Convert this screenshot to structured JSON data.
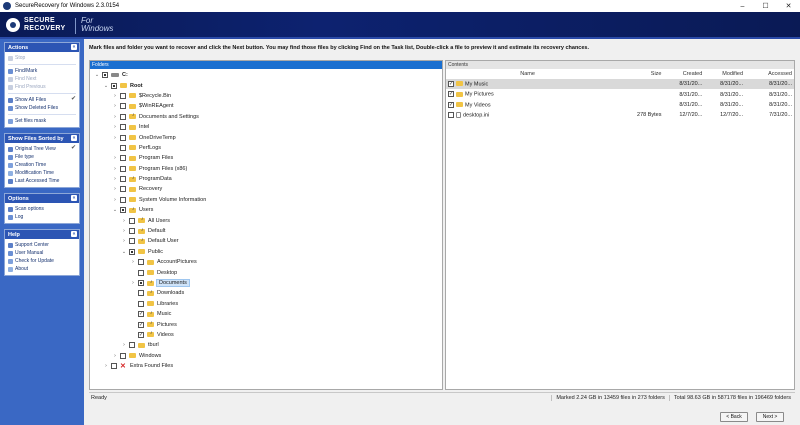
{
  "window": {
    "title": "SecureRecovery for Windows 2.3.0154",
    "minimize": "–",
    "maximize": "☐",
    "close": "✕"
  },
  "banner": {
    "logo_line1": "SECURE",
    "logo_line2": "RECOVERY",
    "logo_sub1": "For",
    "logo_sub2": "Windows"
  },
  "sidebar": {
    "actions": {
      "title": "Actions",
      "items": [
        {
          "label": "Stop",
          "disabled": true
        },
        {
          "label": "Find/Mark"
        },
        {
          "label": "Find Next",
          "disabled": true
        },
        {
          "label": "Find Previous",
          "disabled": true
        },
        {
          "label": "Show All Files",
          "checked": true
        },
        {
          "label": "Show Deleted Files"
        },
        {
          "label": "Set files mask"
        }
      ]
    },
    "sorted": {
      "title": "Show Files Sorted by",
      "items": [
        {
          "label": "Original Tree View",
          "checked": true
        },
        {
          "label": "File type"
        },
        {
          "label": "Creation Time"
        },
        {
          "label": "Modification Time"
        },
        {
          "label": "Last Accessed Time"
        }
      ]
    },
    "options": {
      "title": "Options",
      "items": [
        {
          "label": "Scan options"
        },
        {
          "label": "Log"
        }
      ]
    },
    "help": {
      "title": "Help",
      "items": [
        {
          "label": "Support Center"
        },
        {
          "label": "User Manual"
        },
        {
          "label": "Check for Update"
        },
        {
          "label": "About"
        }
      ]
    },
    "collapse_glyph": "«"
  },
  "main": {
    "instruction": "Mark files and folder you want to recover and click the Next button. You may find those files by clicking Find on the Task list, Double-click a file to preview it and estimate its recovery chances.",
    "folders_header": "Folders",
    "contents_header": "Contents",
    "tree": [
      {
        "label": "C:",
        "depth": 0,
        "exp": "⌄",
        "cb": "part",
        "icon": "drive",
        "bold": true
      },
      {
        "label": "Root",
        "depth": 1,
        "exp": "⌄",
        "cb": "part",
        "icon": "folder",
        "bold": true
      },
      {
        "label": "$Recycle.Bin",
        "depth": 2,
        "exp": "›",
        "cb": "",
        "icon": "folder"
      },
      {
        "label": "$WinREAgent",
        "depth": 2,
        "exp": "›",
        "cb": "",
        "icon": "folder"
      },
      {
        "label": "Documents and Settings",
        "depth": 2,
        "exp": "›",
        "cb": "",
        "icon": "music"
      },
      {
        "label": "Intel",
        "depth": 2,
        "exp": "›",
        "cb": "",
        "icon": "folder"
      },
      {
        "label": "OneDriveTemp",
        "depth": 2,
        "exp": "›",
        "cb": "",
        "icon": "folder"
      },
      {
        "label": "PerfLogs",
        "depth": 2,
        "exp": "",
        "cb": "",
        "icon": "folder"
      },
      {
        "label": "Program Files",
        "depth": 2,
        "exp": "›",
        "cb": "",
        "icon": "folder"
      },
      {
        "label": "Program Files (x86)",
        "depth": 2,
        "exp": "›",
        "cb": "",
        "icon": "folder"
      },
      {
        "label": "ProgramData",
        "depth": 2,
        "exp": "›",
        "cb": "",
        "icon": "music"
      },
      {
        "label": "Recovery",
        "depth": 2,
        "exp": "›",
        "cb": "",
        "icon": "folder"
      },
      {
        "label": "System Volume Information",
        "depth": 2,
        "exp": "›",
        "cb": "",
        "icon": "folder"
      },
      {
        "label": "Users",
        "depth": 2,
        "exp": "⌄",
        "cb": "part",
        "icon": "music"
      },
      {
        "label": "All Users",
        "depth": 3,
        "exp": "›",
        "cb": "",
        "icon": "music"
      },
      {
        "label": "Default",
        "depth": 3,
        "exp": "›",
        "cb": "",
        "icon": "music"
      },
      {
        "label": "Default User",
        "depth": 3,
        "exp": "›",
        "cb": "",
        "icon": "music"
      },
      {
        "label": "Public",
        "depth": 3,
        "exp": "⌄",
        "cb": "part",
        "icon": "folder"
      },
      {
        "label": "AccountPictures",
        "depth": 4,
        "exp": "›",
        "cb": "",
        "icon": "folder"
      },
      {
        "label": "Desktop",
        "depth": 4,
        "exp": "",
        "cb": "",
        "icon": "folder"
      },
      {
        "label": "Documents",
        "depth": 4,
        "exp": "›",
        "cb": "part",
        "icon": "music",
        "selected": true
      },
      {
        "label": "Downloads",
        "depth": 4,
        "exp": "",
        "cb": "",
        "icon": "music"
      },
      {
        "label": "Libraries",
        "depth": 4,
        "exp": "",
        "cb": "",
        "icon": "folder"
      },
      {
        "label": "Music",
        "depth": 4,
        "exp": "",
        "cb": "check",
        "icon": "music"
      },
      {
        "label": "Pictures",
        "depth": 4,
        "exp": "",
        "cb": "check",
        "icon": "music"
      },
      {
        "label": "Videos",
        "depth": 4,
        "exp": "",
        "cb": "check",
        "icon": "music"
      },
      {
        "label": "tburl",
        "depth": 3,
        "exp": "›",
        "cb": "",
        "icon": "folder"
      },
      {
        "label": "Windows",
        "depth": 2,
        "exp": "›",
        "cb": "",
        "icon": "folder"
      },
      {
        "label": "Extra Found Files",
        "depth": 1,
        "exp": "›",
        "cb": "",
        "icon": "x"
      }
    ],
    "columns": [
      "Name",
      "Size",
      "Created",
      "Modified",
      "Accessed"
    ],
    "files": [
      {
        "name": "My Music",
        "size": "",
        "created": "8/31/20...",
        "modified": "8/31/20...",
        "accessed": "8/31/20...",
        "icon": "folder",
        "checked": true,
        "selected": true
      },
      {
        "name": "My Pictures",
        "size": "",
        "created": "8/31/20...",
        "modified": "8/31/20...",
        "accessed": "8/31/20...",
        "icon": "folder",
        "checked": true
      },
      {
        "name": "My Videos",
        "size": "",
        "created": "8/31/20...",
        "modified": "8/31/20...",
        "accessed": "8/31/20...",
        "icon": "folder",
        "checked": true
      },
      {
        "name": "desktop.ini",
        "size": "278 Bytes",
        "created": "12/7/20...",
        "modified": "12/7/20...",
        "accessed": "7/31/20...",
        "icon": "doc",
        "checked": false
      }
    ]
  },
  "status": {
    "left": "Ready",
    "mid": "Marked 2.24 GB in 13459 files in 273 folders",
    "right": "Total 98.63 GB in 587178 files in 196469 folders"
  },
  "buttons": {
    "back": "< Back",
    "next": "Next >"
  },
  "colors": {
    "banner": "#0d2270",
    "sidebar": "#3a68c4",
    "folder": "#f1c445",
    "folders_header": "#1a6fd0"
  }
}
